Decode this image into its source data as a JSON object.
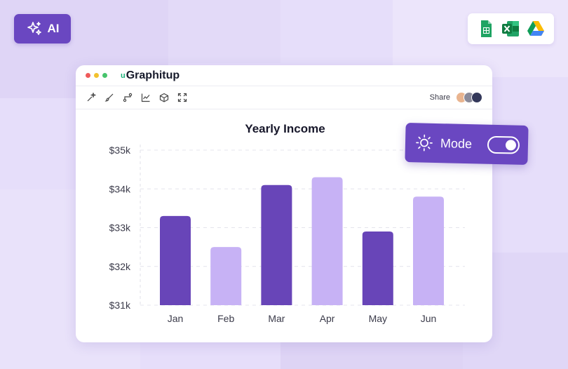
{
  "ai_button": {
    "label": "AI",
    "icon": "sparkle-icon"
  },
  "integrations": [
    {
      "name": "google-sheets-icon"
    },
    {
      "name": "excel-icon"
    },
    {
      "name": "google-drive-icon"
    }
  ],
  "window": {
    "brand": "Graphitup",
    "brand_mark": "u",
    "toolbar_icons": [
      "magic-wand-icon",
      "brush-icon",
      "connector-icon",
      "line-chart-icon",
      "cube-icon",
      "expand-icon"
    ],
    "share_label": "Share"
  },
  "mode_toggle": {
    "label": "Mode",
    "icon": "sun-icon",
    "state": "on"
  },
  "colors": {
    "accent": "#6a47c1",
    "bar_dark": "#6845b8",
    "bar_light": "#c7b2f5"
  },
  "chart_data": {
    "type": "bar",
    "title": "Yearly Income",
    "categories": [
      "Jan",
      "Feb",
      "Mar",
      "Apr",
      "May",
      "Jun"
    ],
    "values": [
      33.3,
      32.5,
      34.1,
      34.3,
      32.9,
      33.8
    ],
    "y_ticks": [
      "$35k",
      "$34k",
      "$33k",
      "$32k",
      "$31k"
    ],
    "y_tick_values": [
      35,
      34,
      33,
      32,
      31
    ],
    "ylim": [
      31,
      35
    ],
    "grid": true,
    "bar_colors": [
      "dark",
      "light",
      "dark",
      "light",
      "dark",
      "light"
    ]
  }
}
